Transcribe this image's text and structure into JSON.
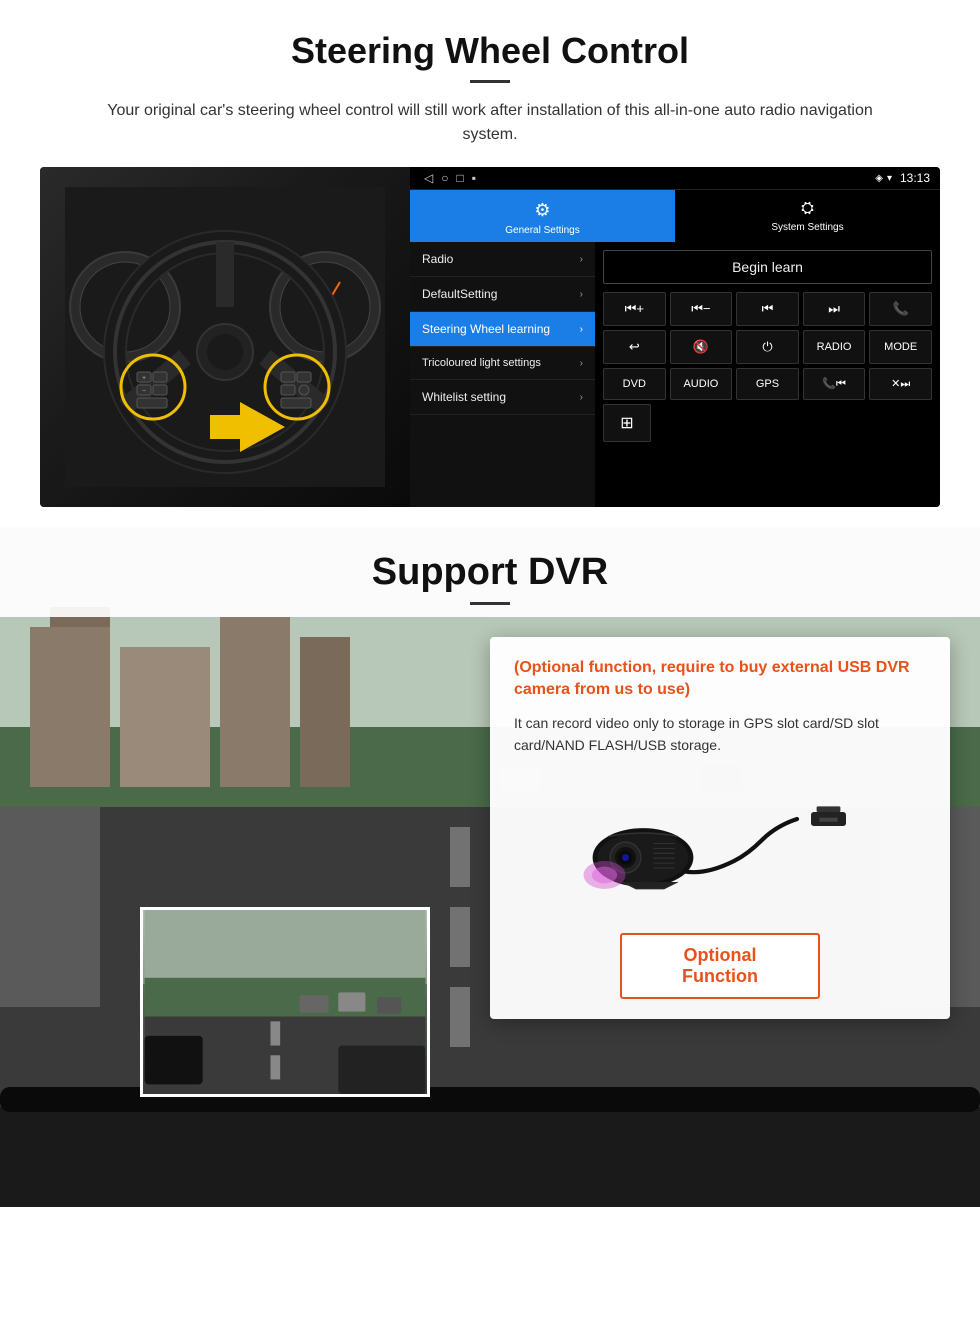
{
  "steering_section": {
    "title": "Steering Wheel Control",
    "subtitle": "Your original car's steering wheel control will still work after installation of this all-in-one auto radio navigation system.",
    "status_bar": {
      "time": "13:13",
      "signal": "▼",
      "wifi": "▾"
    },
    "tabs": [
      {
        "id": "general",
        "label": "General Settings",
        "icon": "⚙",
        "active": true
      },
      {
        "id": "system",
        "label": "System Settings",
        "icon": "🔗",
        "active": false
      }
    ],
    "menu_items": [
      {
        "label": "Radio",
        "active": false
      },
      {
        "label": "DefaultSetting",
        "active": false
      },
      {
        "label": "Steering Wheel learning",
        "active": true
      },
      {
        "label": "Tricoloured light settings",
        "active": false
      },
      {
        "label": "Whitelist setting",
        "active": false
      }
    ],
    "begin_learn_label": "Begin learn",
    "control_rows": [
      [
        "⏮+",
        "⏮−",
        "⏮",
        "⏭",
        "📞"
      ],
      [
        "↩",
        "🔇",
        "⏻",
        "RADIO",
        "MODE"
      ],
      [
        "DVD",
        "AUDIO",
        "GPS",
        "📞⏮",
        "✕⏭"
      ],
      [
        "📋"
      ]
    ]
  },
  "dvr_section": {
    "title": "Support DVR",
    "optional_text": "(Optional function, require to buy external USB DVR camera from us to use)",
    "description": "It can record video only to storage in GPS slot card/SD slot card/NAND FLASH/USB storage.",
    "optional_function_label": "Optional Function"
  }
}
